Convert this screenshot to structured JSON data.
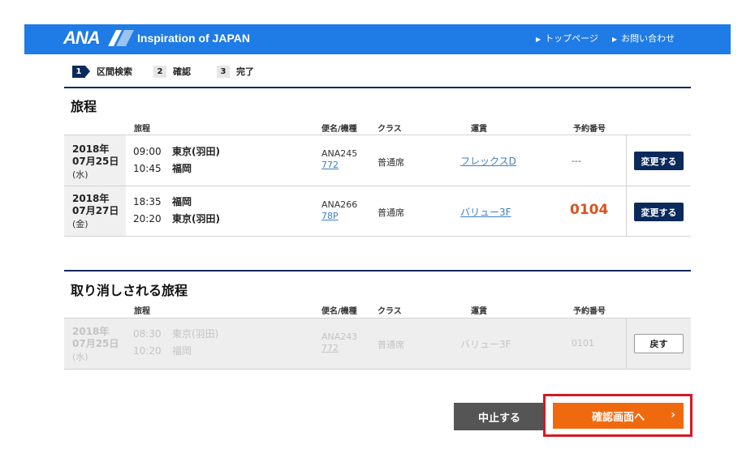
{
  "header": {
    "logo": "ANA",
    "tagline": "Inspiration of JAPAN",
    "nav": [
      {
        "label": "トップページ"
      },
      {
        "label": "お問い合わせ"
      }
    ]
  },
  "steps": [
    {
      "num": "1",
      "label": "区間検索"
    },
    {
      "num": "2",
      "label": "確認"
    },
    {
      "num": "3",
      "label": "完了"
    }
  ],
  "columns": {
    "itinerary": "旅程",
    "flight": "便名/機種",
    "class": "クラス",
    "fare": "運賃",
    "reservation": "予約番号"
  },
  "itinerary": {
    "title": "旅程",
    "rows": [
      {
        "year": "2018年",
        "date": "07月25日",
        "dow": "(水)",
        "dep_time": "09:00",
        "dep_place": "東京(羽田)",
        "arr_time": "10:45",
        "arr_place": "福岡",
        "flight": "ANA245",
        "aircraft": "772",
        "class": "普通席",
        "fare": "フレックスD",
        "reservation": "---",
        "button": "変更する"
      },
      {
        "year": "2018年",
        "date": "07月27日",
        "dow": "(金)",
        "dep_time": "18:35",
        "dep_place": "福岡",
        "arr_time": "20:20",
        "arr_place": "東京(羽田)",
        "flight": "ANA266",
        "aircraft": "78P",
        "class": "普通席",
        "fare": "バリュー3F",
        "reservation": "0104",
        "button": "変更する"
      }
    ]
  },
  "canceled": {
    "title": "取り消しされる旅程",
    "rows": [
      {
        "year": "2018年",
        "date": "07月25日",
        "dow": "(水)",
        "dep_time": "08:30",
        "dep_place": "東京(羽田)",
        "arr_time": "10:20",
        "arr_place": "福岡",
        "flight": "ANA243",
        "aircraft": "772",
        "class": "普通席",
        "fare": "バリュー3F",
        "reservation": "0101",
        "button": "戻す"
      }
    ]
  },
  "footer": {
    "stop": "中止する",
    "confirm": "確認画面へ",
    "confirm_icon": "›"
  },
  "colors": {
    "header_blue": "#1f7be6",
    "navy": "#0b2a5b",
    "orange": "#ef6a0f",
    "highlight_red": "#d71920",
    "reservation_orange": "#d9531e"
  }
}
